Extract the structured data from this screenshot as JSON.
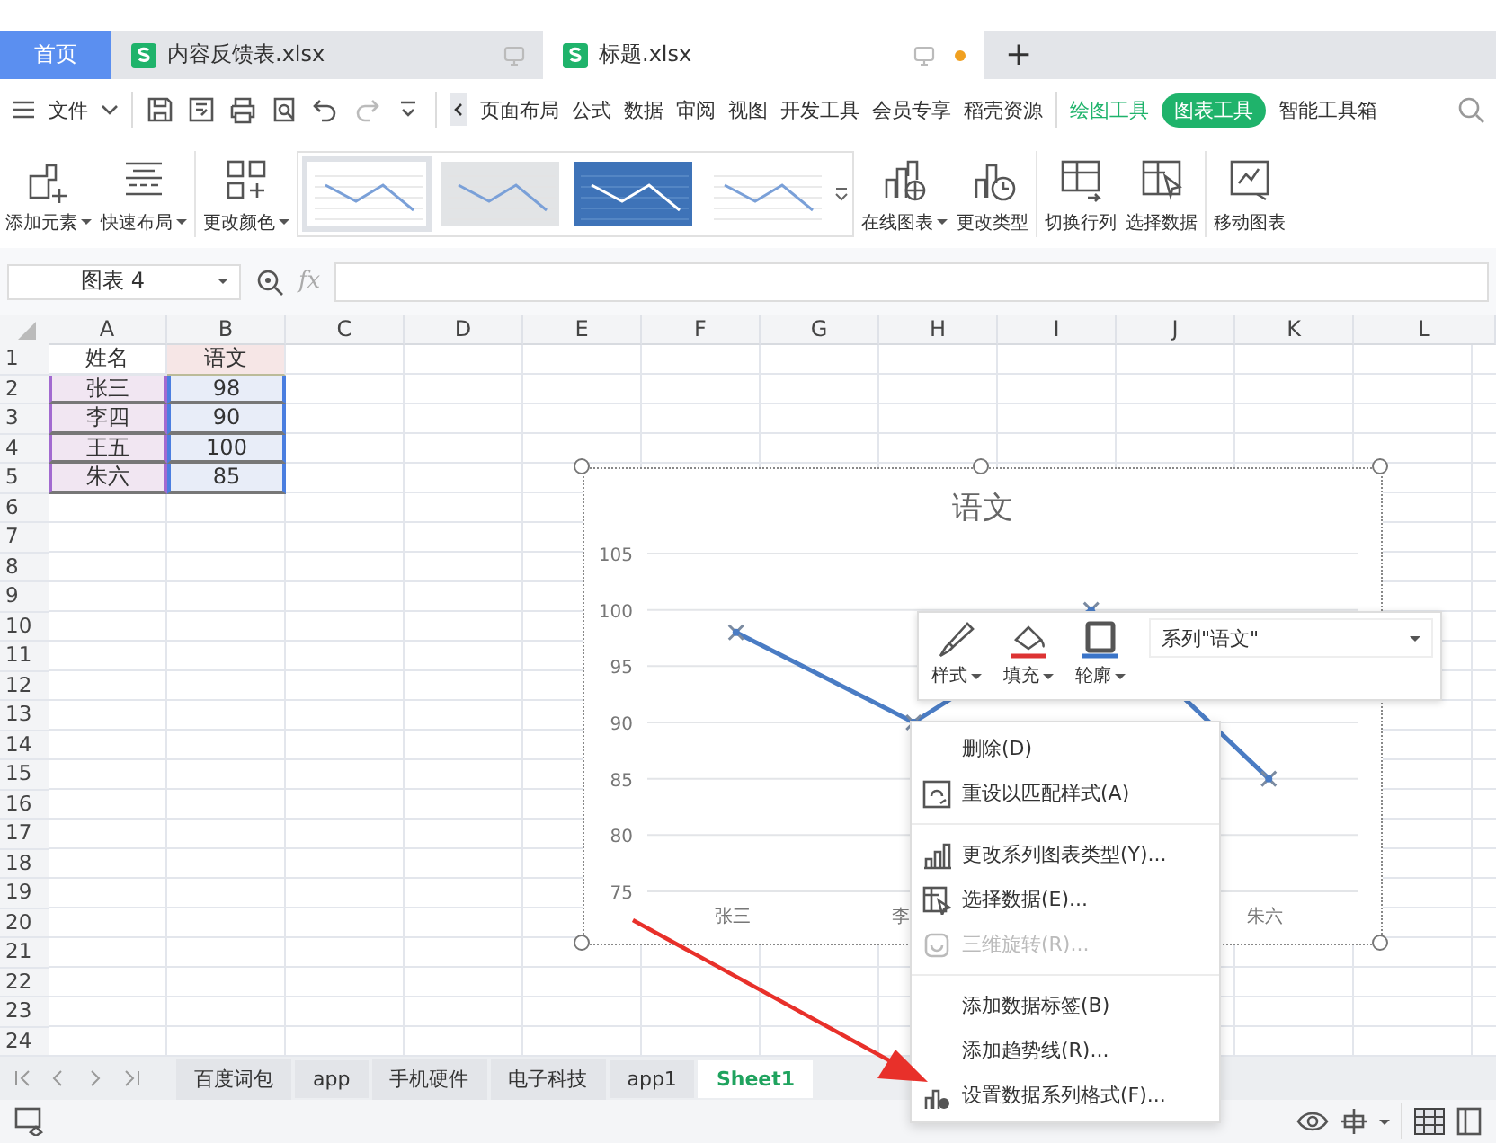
{
  "tabs": [
    {
      "label": "首页",
      "kind": "home",
      "selected": false
    },
    {
      "label": "内容反馈表.xlsx",
      "kind": "file",
      "selected": false,
      "unsaved": false
    },
    {
      "label": "标题.xlsx",
      "kind": "file",
      "selected": true,
      "unsaved": true
    }
  ],
  "new_tab": "+",
  "menu_bar": {
    "file": "文件",
    "items": [
      {
        "label": "页面布局",
        "kind": "plain",
        "selected": false
      },
      {
        "label": "公式",
        "kind": "plain",
        "selected": false
      },
      {
        "label": "数据",
        "kind": "plain",
        "selected": false
      },
      {
        "label": "审阅",
        "kind": "plain",
        "selected": false
      },
      {
        "label": "视图",
        "kind": "plain",
        "selected": false
      },
      {
        "label": "开发工具",
        "kind": "plain",
        "selected": false
      },
      {
        "label": "会员专享",
        "kind": "plain",
        "selected": false
      },
      {
        "label": "稻壳资源",
        "kind": "plain",
        "selected": false
      },
      {
        "label": "绘图工具",
        "kind": "context",
        "selected": false
      },
      {
        "label": "图表工具",
        "kind": "context",
        "selected": true
      },
      {
        "label": "智能工具箱",
        "kind": "plain",
        "selected": false
      }
    ]
  },
  "ribbon": {
    "left_buttons": [
      {
        "label": "添加元素",
        "dropdown": true
      },
      {
        "label": "快速布局",
        "dropdown": true
      },
      {
        "label": "更改颜色",
        "dropdown": true
      }
    ],
    "chart_styles": [
      {
        "selected": true
      },
      {
        "selected": false
      },
      {
        "selected": false
      },
      {
        "selected": false
      }
    ],
    "right_buttons": [
      {
        "label": "在线图表",
        "dropdown": true
      },
      {
        "label": "更改类型",
        "dropdown": false
      },
      {
        "label": "切换行列",
        "dropdown": false
      },
      {
        "label": "选择数据",
        "dropdown": false
      },
      {
        "label": "移动图表",
        "dropdown": false
      }
    ]
  },
  "formula_bar": {
    "name_box": "图表 4",
    "fx": "fx"
  },
  "sheet": {
    "columns": [
      "A",
      "B",
      "C",
      "D",
      "E",
      "F",
      "G",
      "H",
      "I",
      "J",
      "K",
      "L"
    ],
    "rows": [
      {
        "label": "1",
        "cells": [
          "姓名",
          "语文"
        ]
      },
      {
        "label": "2",
        "cells": [
          "张三",
          "98"
        ]
      },
      {
        "label": "3",
        "cells": [
          "李四",
          "90"
        ]
      },
      {
        "label": "4",
        "cells": [
          "王五",
          "100"
        ]
      },
      {
        "label": "5",
        "cells": [
          "朱六",
          "85"
        ]
      },
      {
        "label": "6",
        "cells": []
      },
      {
        "label": "7",
        "cells": []
      },
      {
        "label": "8",
        "cells": []
      },
      {
        "label": "9",
        "cells": []
      },
      {
        "label": "10",
        "cells": []
      },
      {
        "label": "11",
        "cells": []
      },
      {
        "label": "12",
        "cells": []
      },
      {
        "label": "13",
        "cells": []
      },
      {
        "label": "14",
        "cells": []
      },
      {
        "label": "15",
        "cells": []
      },
      {
        "label": "16",
        "cells": []
      },
      {
        "label": "17",
        "cells": []
      },
      {
        "label": "18",
        "cells": []
      },
      {
        "label": "19",
        "cells": []
      },
      {
        "label": "20",
        "cells": []
      },
      {
        "label": "21",
        "cells": []
      },
      {
        "label": "22",
        "cells": []
      },
      {
        "label": "23",
        "cells": []
      },
      {
        "label": "24",
        "cells": []
      }
    ]
  },
  "chart": {
    "chart_data": {
      "type": "line",
      "title": "语文",
      "categories": [
        "张三",
        "李",
        null,
        "朱六"
      ],
      "series": [
        {
          "color": "#4a7cc4",
          "marker": true,
          "values": [
            98,
            90,
            100,
            85
          ]
        }
      ],
      "grid": true,
      "ylim": [
        75,
        105
      ],
      "yticks": [
        75,
        80,
        85,
        90,
        95,
        100,
        105
      ]
    }
  },
  "chart_toolbar": {
    "buttons": [
      {
        "label": "样式",
        "dropdown": true
      },
      {
        "label": "填充",
        "dropdown": true
      },
      {
        "label": "轮廓",
        "dropdown": true
      }
    ],
    "series_select": "系列\"语文\""
  },
  "context_menu": [
    {
      "kind": "item",
      "label": "删除(D)",
      "disabled": false
    },
    {
      "kind": "item",
      "label": "重设以匹配样式(A)",
      "disabled": false
    },
    {
      "kind": "separator"
    },
    {
      "kind": "item",
      "label": "更改系列图表类型(Y)...",
      "disabled": false
    },
    {
      "kind": "item",
      "label": "选择数据(E)...",
      "disabled": false
    },
    {
      "kind": "item",
      "label": "三维旋转(R)...",
      "disabled": true
    },
    {
      "kind": "separator"
    },
    {
      "kind": "item",
      "label": "添加数据标签(B)",
      "disabled": false
    },
    {
      "kind": "item",
      "label": "添加趋势线(R)...",
      "disabled": false
    },
    {
      "kind": "item",
      "label": "设置数据系列格式(F)...",
      "disabled": false
    }
  ],
  "sheet_tabs": [
    {
      "label": "百度词包",
      "selected": false
    },
    {
      "label": "app",
      "selected": false
    },
    {
      "label": "手机硬件",
      "selected": false
    },
    {
      "label": "电子科技",
      "selected": false
    },
    {
      "label": "app1",
      "selected": false
    },
    {
      "label": "Sheet1",
      "selected": true
    }
  ]
}
